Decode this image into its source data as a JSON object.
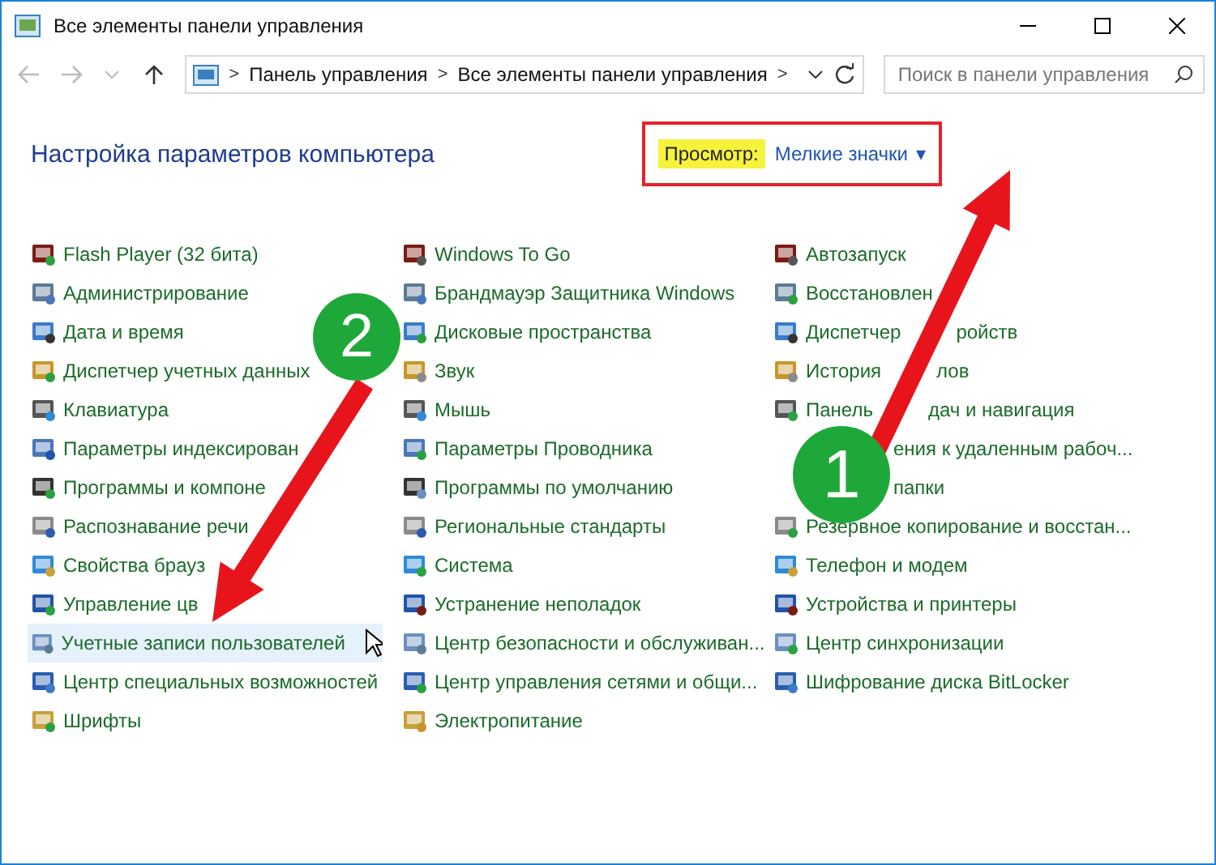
{
  "window": {
    "title": "Все элементы панели управления"
  },
  "address": {
    "crumbs": [
      "Панель управления",
      "Все элементы панели управления"
    ],
    "separator": ">"
  },
  "search": {
    "placeholder": "Поиск в панели управления"
  },
  "heading": "Настройка параметров компьютера",
  "view": {
    "label": "Просмотр:",
    "value": "Мелкие значки",
    "caret": "▾"
  },
  "columns": [
    {
      "items": [
        {
          "label": "Flash Player (32 бита)",
          "selected": false
        },
        {
          "label": "Администрирование",
          "selected": false
        },
        {
          "label": "Дата и время",
          "selected": false
        },
        {
          "label": "Диспетчер учетных данных",
          "selected": false
        },
        {
          "label": "Клавиатура",
          "selected": false
        },
        {
          "label": "Параметры индексирован",
          "selected": false
        },
        {
          "label": "Программы и компоне",
          "selected": false
        },
        {
          "label": "Распознавание речи",
          "selected": false
        },
        {
          "label": "Свойства брауз",
          "selected": false
        },
        {
          "label": "Управление цв",
          "selected": false
        },
        {
          "label": "Учетные записи пользователей",
          "selected": true
        },
        {
          "label": "Центр специальных возможностей",
          "selected": false
        },
        {
          "label": "Шрифты",
          "selected": false
        }
      ]
    },
    {
      "items": [
        {
          "label": "Windows To Go",
          "selected": false
        },
        {
          "label": "Брандмауэр Защитника Windows",
          "selected": false
        },
        {
          "label": "Дисковые пространства",
          "selected": false
        },
        {
          "label": "Звук",
          "selected": false
        },
        {
          "label": "Мышь",
          "selected": false
        },
        {
          "label": "Параметры Проводника",
          "selected": false
        },
        {
          "label": "Программы по умолчанию",
          "selected": false
        },
        {
          "label": "Региональные стандарты",
          "selected": false
        },
        {
          "label": "Система",
          "selected": false
        },
        {
          "label": "Устранение неполадок",
          "selected": false
        },
        {
          "label": "Центр безопасности и обслуживан...",
          "selected": false
        },
        {
          "label": "Центр управления сетями и общи...",
          "selected": false
        },
        {
          "label": "Электропитание",
          "selected": false
        }
      ]
    },
    {
      "items": [
        {
          "label": "Автозапуск",
          "selected": false
        },
        {
          "label": "Восстановлен",
          "selected": false
        },
        {
          "label": "Диспетчер",
          "tail": "ройств",
          "selected": false
        },
        {
          "label": "История",
          "tail": "лов",
          "selected": false
        },
        {
          "label": "Панель",
          "tail": "дач и навигация",
          "selected": false
        },
        {
          "tail": "ения к удаленным рабоч...",
          "selected": false
        },
        {
          "tail": "папки",
          "selected": false
        },
        {
          "label": "Резервное копирование и восстан...",
          "selected": false
        },
        {
          "label": "Телефон и модем",
          "selected": false
        },
        {
          "label": "Устройства и принтеры",
          "selected": false
        },
        {
          "label": "Центр синхронизации",
          "selected": false
        },
        {
          "label": "Шифрование диска BitLocker",
          "selected": false
        }
      ]
    }
  ],
  "annotations": [
    {
      "label": "1"
    },
    {
      "label": "2"
    }
  ]
}
